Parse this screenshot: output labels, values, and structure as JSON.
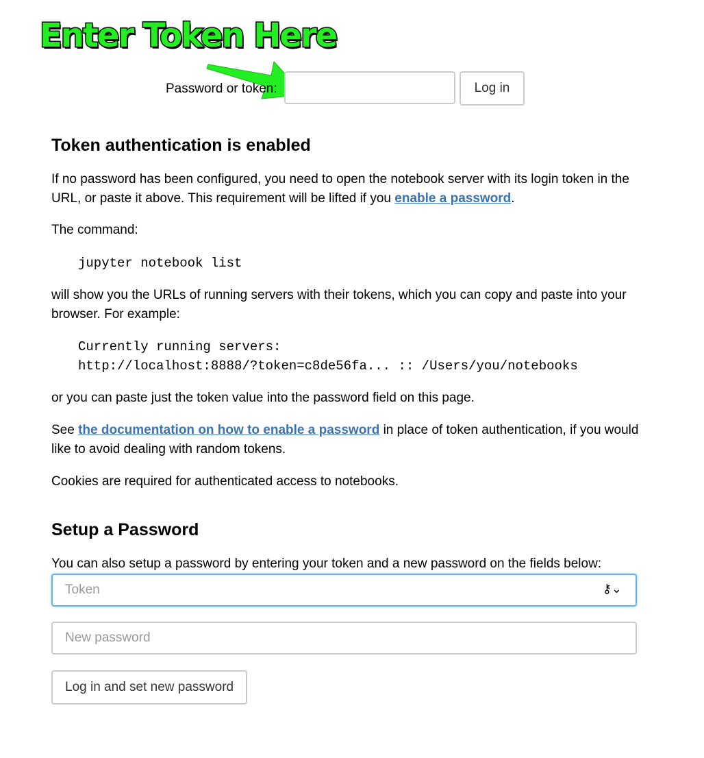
{
  "annotation": {
    "text": "Enter Token Here",
    "color": "#22ee22"
  },
  "login": {
    "label": "Password or token:",
    "input_value": "",
    "button_label": "Log in"
  },
  "token_auth": {
    "heading": "Token authentication is enabled",
    "intro_before_link": "If no password has been configured, you need to open the notebook server with its login token in the URL, or paste it above. This requirement will be lifted if you ",
    "intro_link": "enable a password",
    "intro_after_link": ".",
    "command_intro": "The command:",
    "command": "jupyter notebook list",
    "show_text": "will show you the URLs of running servers with their tokens, which you can copy and paste into your browser. For example:",
    "example_line1": "Currently running servers:",
    "example_line2": "http://localhost:8888/?token=c8de56fa... :: /Users/you/notebooks",
    "paste_text": "or you can paste just the token value into the password field on this page.",
    "docs_before_link": "See ",
    "docs_link": "the documentation on how to enable a password",
    "docs_after_link": " in place of token authentication, if you would like to avoid dealing with random tokens.",
    "cookies_text": "Cookies are required for authenticated access to notebooks."
  },
  "setup": {
    "heading": "Setup a Password",
    "description": "You can also setup a password by entering your token and a new password on the fields below:",
    "token_placeholder": "Token",
    "key_icon": "key-icon",
    "new_password_placeholder": "New password",
    "button_label": "Log in and set new password"
  },
  "colors": {
    "link": "#3b73af",
    "focus_border": "#66afe9",
    "input_border": "#cccccc",
    "arrow": "#22ee22"
  }
}
